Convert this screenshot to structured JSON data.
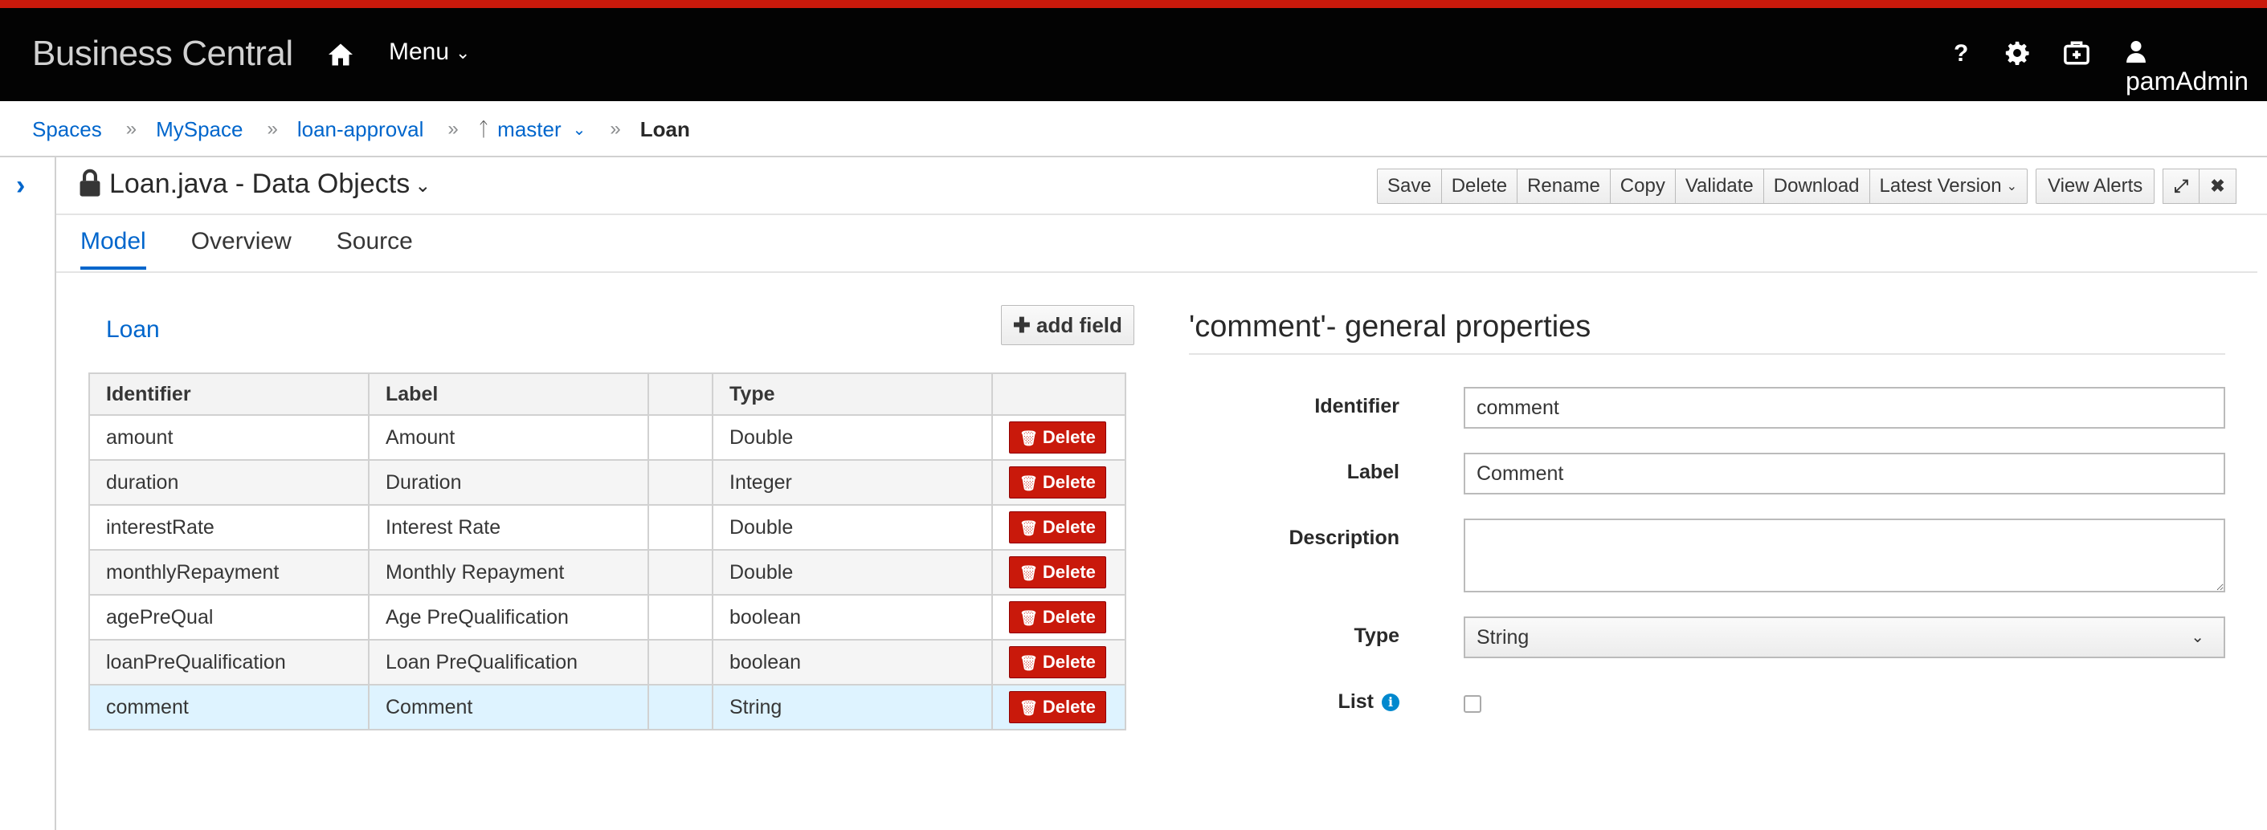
{
  "header": {
    "brand": "Business Central",
    "menu_label": "Menu",
    "help_label": "?",
    "username": "pamAdmin"
  },
  "breadcrumb": {
    "items": [
      "Spaces",
      "MySpace",
      "loan-approval"
    ],
    "branch": "master",
    "current": "Loan"
  },
  "editor": {
    "title": "Loan.java - Data Objects",
    "toolbar": [
      "Save",
      "Delete",
      "Rename",
      "Copy",
      "Validate",
      "Download"
    ],
    "version_label": "Latest Version",
    "alerts_label": "View Alerts",
    "tabs": [
      "Model",
      "Overview",
      "Source"
    ],
    "active_tab": "Model"
  },
  "data_object": {
    "name": "Loan",
    "add_field_label": "add field",
    "columns": [
      "Identifier",
      "Label",
      "",
      "Type",
      ""
    ],
    "delete_label": "Delete",
    "rows": [
      {
        "identifier": "amount",
        "label": "Amount",
        "type": "Double"
      },
      {
        "identifier": "duration",
        "label": "Duration",
        "type": "Integer"
      },
      {
        "identifier": "interestRate",
        "label": "Interest Rate",
        "type": "Double"
      },
      {
        "identifier": "monthlyRepayment",
        "label": "Monthly Repayment",
        "type": "Double"
      },
      {
        "identifier": "agePreQual",
        "label": "Age PreQualification",
        "type": "boolean"
      },
      {
        "identifier": "loanPreQualification",
        "label": "Loan PreQualification",
        "type": "boolean"
      },
      {
        "identifier": "comment",
        "label": "Comment",
        "type": "String"
      }
    ],
    "selected_row": 6
  },
  "properties": {
    "title": "'comment'- general properties",
    "identifier_label": "Identifier",
    "identifier_value": "comment",
    "label_label": "Label",
    "label_value": "Comment",
    "description_label": "Description",
    "description_value": "",
    "type_label": "Type",
    "type_value": "String",
    "list_label": "List",
    "list_checked": false
  },
  "colors": {
    "accent": "#0066cc",
    "danger": "#c9190b",
    "header_bg": "#030303",
    "selected_row": "#def3ff"
  }
}
